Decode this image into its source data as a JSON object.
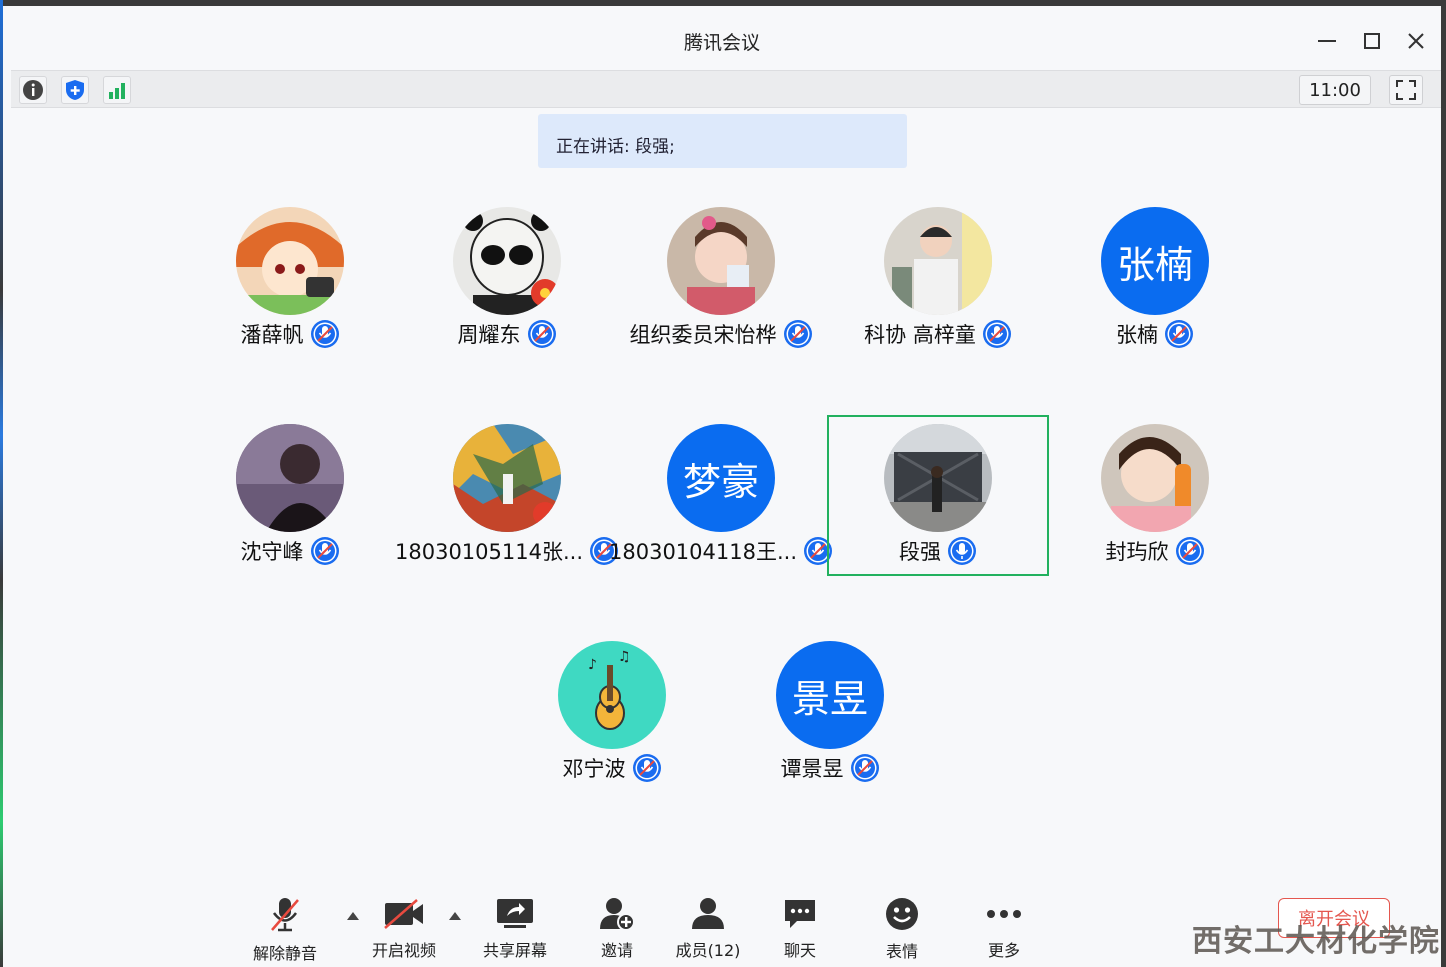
{
  "window": {
    "title": "腾讯会议"
  },
  "toolbar": {
    "icons": [
      "info-icon",
      "shield-icon",
      "signal-icon"
    ],
    "time": "11:00"
  },
  "speaking_banner": "正在讲话: 段强;",
  "participants": [
    {
      "name": "潘薛帆",
      "avatar": "anime",
      "muted": true
    },
    {
      "name": "周耀东",
      "avatar": "panda",
      "muted": true
    },
    {
      "name": "组织委员宋怡桦",
      "avatar": "child-photo",
      "muted": true
    },
    {
      "name": "科协 高梓童",
      "avatar": "person-photo",
      "muted": true
    },
    {
      "name": "张楠",
      "avatar_text": "张楠",
      "muted": true
    },
    {
      "name": "沈守峰",
      "avatar": "person-dark",
      "muted": true
    },
    {
      "name": "18030105114张...",
      "avatar": "colorful-wall",
      "muted": true
    },
    {
      "name": "18030104118王...",
      "avatar_text": "梦豪",
      "muted": true
    },
    {
      "name": "段强",
      "avatar": "bridge-photo",
      "muted": false,
      "speaking": true
    },
    {
      "name": "封玙欣",
      "avatar": "girl-photo",
      "muted": true
    },
    {
      "name": "邓宁波",
      "avatar": "guitar",
      "muted": true
    },
    {
      "name": "谭景昱",
      "avatar_text": "景昱",
      "muted": true
    }
  ],
  "bottom_bar": {
    "unmute": "解除静音",
    "start_video": "开启视频",
    "share_screen": "共享屏幕",
    "invite": "邀请",
    "members": "成员(12)",
    "chat": "聊天",
    "reactions": "表情",
    "more": "更多",
    "leave": "离开会议"
  },
  "watermark": "西安工大材化学院",
  "colors": {
    "accent": "#0a6cf0",
    "speaking_border": "#22b15e",
    "leave": "#e4574f",
    "banner": "#dde9fb"
  }
}
